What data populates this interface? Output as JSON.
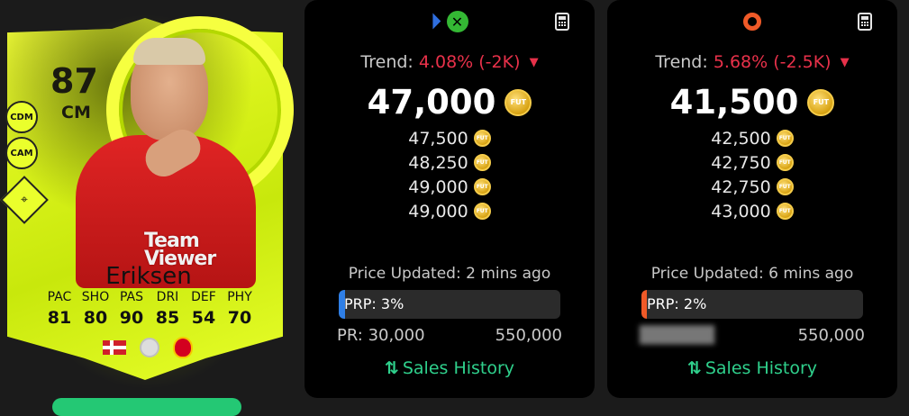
{
  "player": {
    "name": "Eriksen",
    "rating": "87",
    "position": "CM",
    "alt_positions": [
      "CDM",
      "CAM"
    ],
    "sponsor_line1": "Team",
    "sponsor_line2": "Viewer",
    "stats": [
      {
        "label": "PAC",
        "value": "81"
      },
      {
        "label": "SHO",
        "value": "80"
      },
      {
        "label": "PAS",
        "value": "90"
      },
      {
        "label": "DRI",
        "value": "85"
      },
      {
        "label": "DEF",
        "value": "54"
      },
      {
        "label": "PHY",
        "value": "70"
      }
    ],
    "nation_icon": "denmark-flag-icon",
    "league_icon": "premier-league-icon",
    "club_icon": "manchester-united-crest-icon",
    "card_color": "#e3f71e"
  },
  "coin_text": "FUT",
  "console_panel": {
    "platform_icons": [
      "playstation-icon",
      "xbox-icon"
    ],
    "ps_glyph": "⏵",
    "xbox_glyph": "✕",
    "trend_label": "Trend:",
    "trend_value": "4.08% (-2K)",
    "trend_direction": "down",
    "price": "47,000",
    "prices": [
      "47,500",
      "48,250",
      "49,000",
      "49,000"
    ],
    "updated": "Price Updated: 2 mins ago",
    "prp_label": "PRP: 3%",
    "prp_percent": 3,
    "prp_color": "#2f7fe6",
    "pr_min": "PR: 30,000",
    "pr_max": "550,000",
    "sales_history": "Sales History"
  },
  "pc_panel": {
    "platform_icons": [
      "origin-icon"
    ],
    "trend_label": "Trend:",
    "trend_value": "5.68% (-2.5K)",
    "trend_direction": "down",
    "price": "41,500",
    "prices": [
      "42,500",
      "42,750",
      "42,750",
      "43,000"
    ],
    "updated": "Price Updated: 6 mins ago",
    "prp_label": "PRP: 2%",
    "prp_percent": 2,
    "prp_color": "#f05a28",
    "pr_max": "550,000",
    "sales_history": "Sales History"
  },
  "colors": {
    "trend_down": "#e8314a",
    "sales_link": "#2fd08c",
    "panel_bg": "#000000",
    "page_bg": "#1b1b1b"
  }
}
